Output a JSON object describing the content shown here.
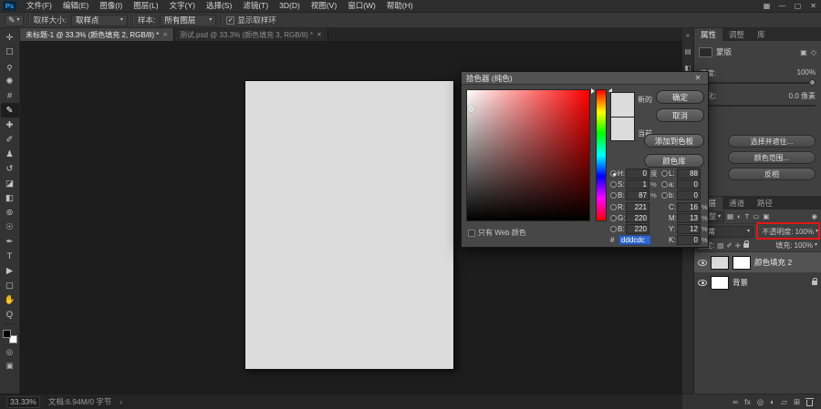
{
  "app": {
    "logo": "Ps"
  },
  "icons": {
    "caret_down": "▾",
    "check": "✓",
    "close": "✕",
    "minimize": "—",
    "maximize": "▢",
    "workspace": "▦",
    "collapse_panels": "«",
    "chevron_right": "›",
    "dock_panel_1": "▤",
    "dock_panel_2": "◧",
    "pixel_mask": "▣",
    "vector_mask": "◇",
    "filter_pixel": "▦",
    "filter_adjustment": "◐",
    "filter_type": "T",
    "filter_shape": "▭",
    "filter_smart": "▣",
    "filter_toggle": "◉",
    "lock_transparency": "▨",
    "lock_pixels": "✐",
    "lock_position": "✛",
    "lock_artboard": "▣",
    "link": "∞",
    "effects": "fx",
    "add_mask": "◎",
    "adjustment": "◐",
    "group": "▱",
    "new_layer": "⊞",
    "eyedropper": "✎",
    "quick_mask": "◎",
    "screen_mode": "▣"
  },
  "menubar": {
    "menus": [
      "文件(F)",
      "编辑(E)",
      "图像(I)",
      "图层(L)",
      "文字(Y)",
      "选择(S)",
      "滤镜(T)",
      "3D(D)",
      "视图(V)",
      "窗口(W)",
      "帮助(H)"
    ]
  },
  "options_bar": {
    "sample_size_label": "取样大小:",
    "sample_size_value": "取样点",
    "sample_label": "样本:",
    "sample_value": "所有图层",
    "show_ring_label": "显示取样环"
  },
  "tabs": [
    "未标题-1 @ 33.3% (颜色填充 2, RGB/8) *",
    "测试.psd @ 33.3% (颜色填充 3, RGB/8) *"
  ],
  "tools": [
    {
      "name": "move-tool",
      "glyph": "✛"
    },
    {
      "name": "marquee-tool",
      "glyph": "☐"
    },
    {
      "name": "lasso-tool",
      "glyph": "ϙ"
    },
    {
      "name": "quick-selection-tool",
      "glyph": "✺"
    },
    {
      "name": "crop-tool",
      "glyph": "#"
    },
    {
      "name": "eyedropper-tool",
      "glyph": "✎"
    },
    {
      "name": "spot-healing-tool",
      "glyph": "✚"
    },
    {
      "name": "brush-tool",
      "glyph": "✐"
    },
    {
      "name": "clone-stamp-tool",
      "glyph": "♟"
    },
    {
      "name": "history-brush-tool",
      "glyph": "↺"
    },
    {
      "name": "eraser-tool",
      "glyph": "◪"
    },
    {
      "name": "gradient-tool",
      "glyph": "◧"
    },
    {
      "name": "blur-tool",
      "glyph": "⊚"
    },
    {
      "name": "dodge-tool",
      "glyph": "☉"
    },
    {
      "name": "pen-tool",
      "glyph": "✒"
    },
    {
      "name": "type-tool",
      "glyph": "T"
    },
    {
      "name": "path-selection-tool",
      "glyph": "▶"
    },
    {
      "name": "shape-tool",
      "glyph": "▢"
    },
    {
      "name": "hand-tool",
      "glyph": "✋"
    },
    {
      "name": "zoom-tool",
      "glyph": "Q"
    }
  ],
  "toolbar_colors": {
    "foreground": "#000000",
    "background": "#ffffff"
  },
  "canvas": {
    "doc_color": "#dddcdc"
  },
  "color_picker": {
    "title": "拾色器 (纯色)",
    "ok": "确定",
    "cancel": "取消",
    "add_to_swatches": "添加到色板",
    "color_libraries": "颜色库",
    "new_label": "新的",
    "current_label": "当前",
    "web_only": "只有 Web 颜色",
    "hex_prefix": "#",
    "hex": "dddcdc",
    "new_color": "#dddcdc",
    "current_color": "#dddcdc",
    "fields": [
      {
        "label": "H:",
        "value": "0",
        "unit": "度"
      },
      {
        "label": "S:",
        "value": "1",
        "unit": "%"
      },
      {
        "label": "B:",
        "value": "87",
        "unit": "%"
      },
      {
        "label": "R:",
        "value": "221",
        "unit": ""
      },
      {
        "label": "G:",
        "value": "220",
        "unit": ""
      },
      {
        "label": "B:",
        "value": "220",
        "unit": ""
      },
      {
        "label": "L:",
        "value": "88",
        "unit": ""
      },
      {
        "label": "a:",
        "value": "0",
        "unit": ""
      },
      {
        "label": "b:",
        "value": "0",
        "unit": ""
      },
      {
        "label": "C:",
        "value": "16",
        "unit": "%"
      },
      {
        "label": "M:",
        "value": "13",
        "unit": "%"
      },
      {
        "label": "Y:",
        "value": "12",
        "unit": "%"
      },
      {
        "label": "K:",
        "value": "0",
        "unit": "%"
      }
    ]
  },
  "properties_panel": {
    "tabs": [
      "属性",
      "调整",
      "库"
    ],
    "mask_label": "蒙版",
    "density_label": "浓度:",
    "density_value": "100%",
    "feather_label": "羽化:",
    "feather_value": "0.0 像素",
    "buttons": [
      "选择并遮住...",
      "颜色范围...",
      "反相"
    ]
  },
  "layers_panel": {
    "tabs": [
      "图层",
      "通道",
      "路径"
    ],
    "filter_label": "类型",
    "blend_mode": "正常",
    "opacity_label": "不透明度:",
    "opacity_value": "100%",
    "lock_label": "锁定:",
    "fill_label": "填充:",
    "fill_value": "100%",
    "layers": [
      {
        "name": "颜色填充 2",
        "thumb": "#dddcdc",
        "mask": "#ffffff"
      },
      {
        "name": "背景",
        "thumb": "#ffffff"
      }
    ]
  },
  "status_bar": {
    "zoom": "33.33%",
    "doc_info": "文档:6.94M/0 字节"
  }
}
